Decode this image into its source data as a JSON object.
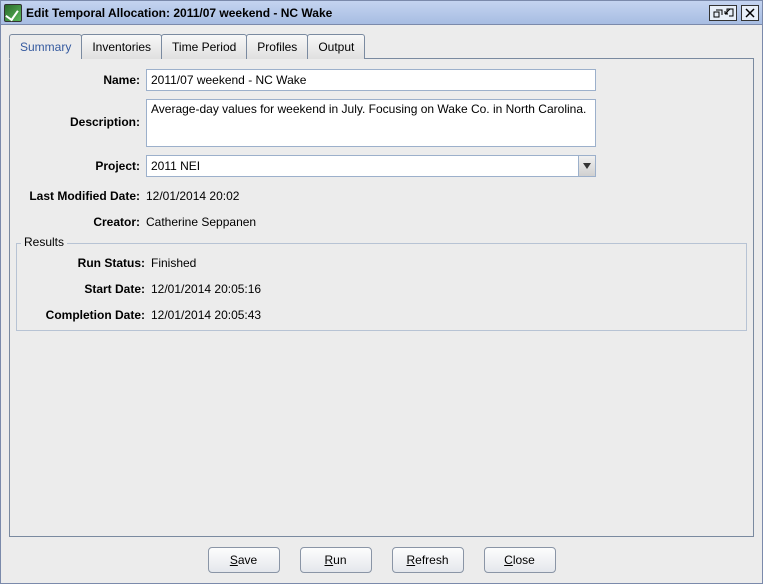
{
  "window": {
    "title": "Edit Temporal Allocation: 2011/07 weekend - NC Wake"
  },
  "tabs": [
    "Summary",
    "Inventories",
    "Time Period",
    "Profiles",
    "Output"
  ],
  "activeTab": "Summary",
  "labels": {
    "name": "Name:",
    "description": "Description:",
    "project": "Project:",
    "lastModified": "Last Modified Date:",
    "creator": "Creator:",
    "results": "Results",
    "runStatus": "Run Status:",
    "startDate": "Start Date:",
    "completionDate": "Completion Date:"
  },
  "values": {
    "name": "2011/07 weekend - NC Wake",
    "description": "Average-day values for weekend in July. Focusing on Wake Co. in North Carolina.",
    "project": "2011 NEI",
    "lastModified": "12/01/2014 20:02",
    "creator": "Catherine Seppanen",
    "runStatus": "Finished",
    "startDate": "12/01/2014 20:05:16",
    "completionDate": "12/01/2014 20:05:43"
  },
  "buttons": {
    "save": {
      "mnemonic": "S",
      "rest": "ave"
    },
    "run": {
      "mnemonic": "R",
      "rest": "un"
    },
    "refresh": {
      "mnemonic": "R",
      "rest": "efresh"
    },
    "close": {
      "mnemonic": "C",
      "rest": "lose"
    }
  }
}
